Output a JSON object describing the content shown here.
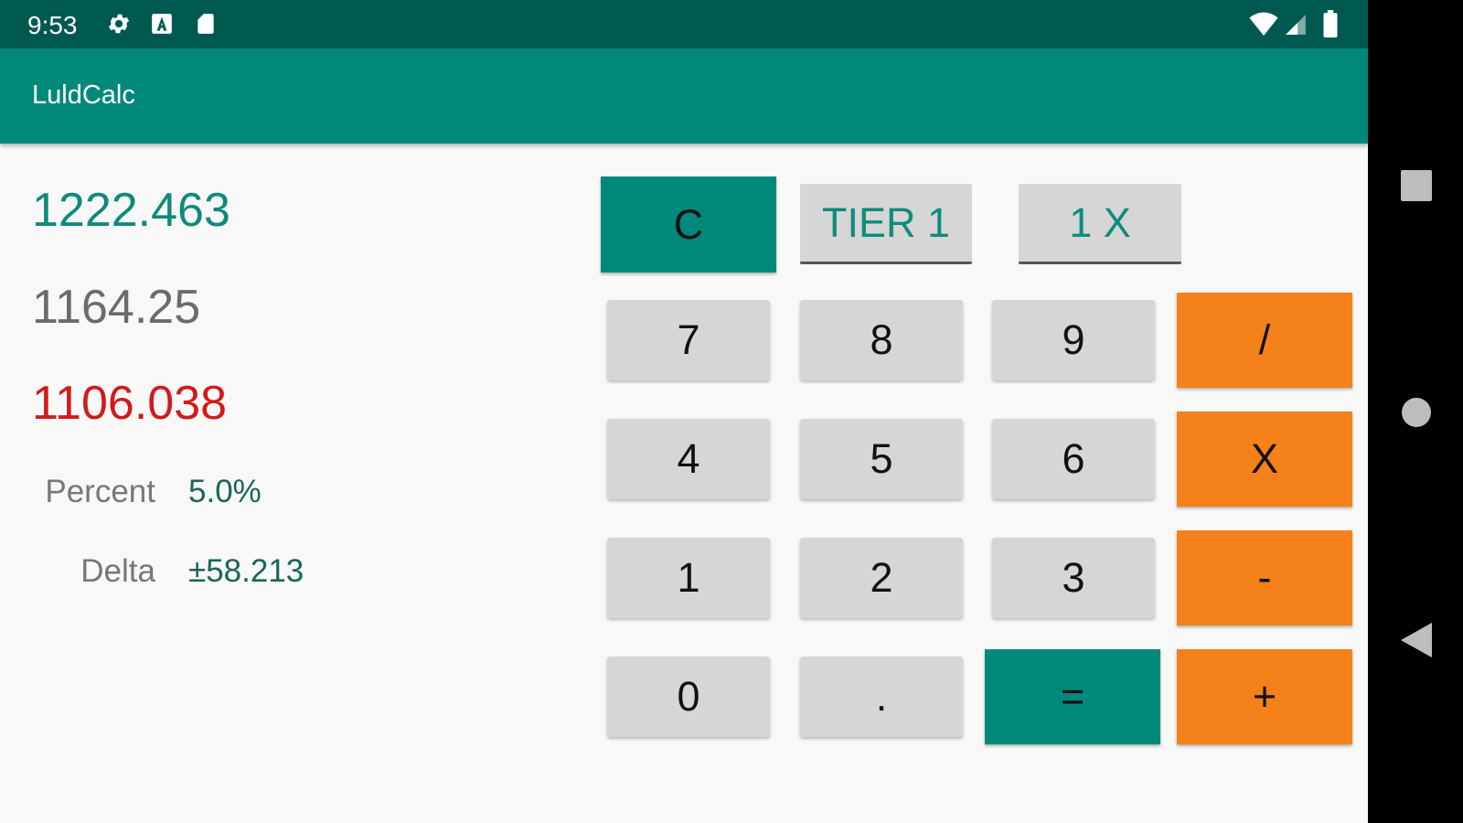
{
  "status_bar": {
    "time": "9:53",
    "icons": [
      "gear-icon",
      "a-badge-icon",
      "sd-card-icon",
      "wifi-icon",
      "cell-signal-icon",
      "battery-icon"
    ]
  },
  "app_bar": {
    "title": "LuldCalc"
  },
  "readouts": {
    "upper_bound": "1222.463",
    "value": "1164.25",
    "lower_bound": "1106.038"
  },
  "info": {
    "percent_label": "Percent",
    "percent_value": "5.0%",
    "delta_label": "Delta",
    "delta_value": "±58.213"
  },
  "keypad": {
    "clear": "C",
    "tier": "TIER 1",
    "multiplier": "1 X",
    "k7": "7",
    "k8": "8",
    "k9": "9",
    "divide": "/",
    "k4": "4",
    "k5": "5",
    "k6": "6",
    "multiply": "X",
    "k1": "1",
    "k2": "2",
    "k3": "3",
    "minus": "-",
    "k0": "0",
    "dot": ".",
    "equals": "=",
    "plus": "+"
  },
  "colors": {
    "status_bar": "#00594f",
    "app_bar": "#00897b",
    "upper": "#0e8a7b",
    "value": "#6b6b6b",
    "lower": "#d11b1b",
    "operator": "#f4811a",
    "digit_key": "#d6d6d6"
  }
}
